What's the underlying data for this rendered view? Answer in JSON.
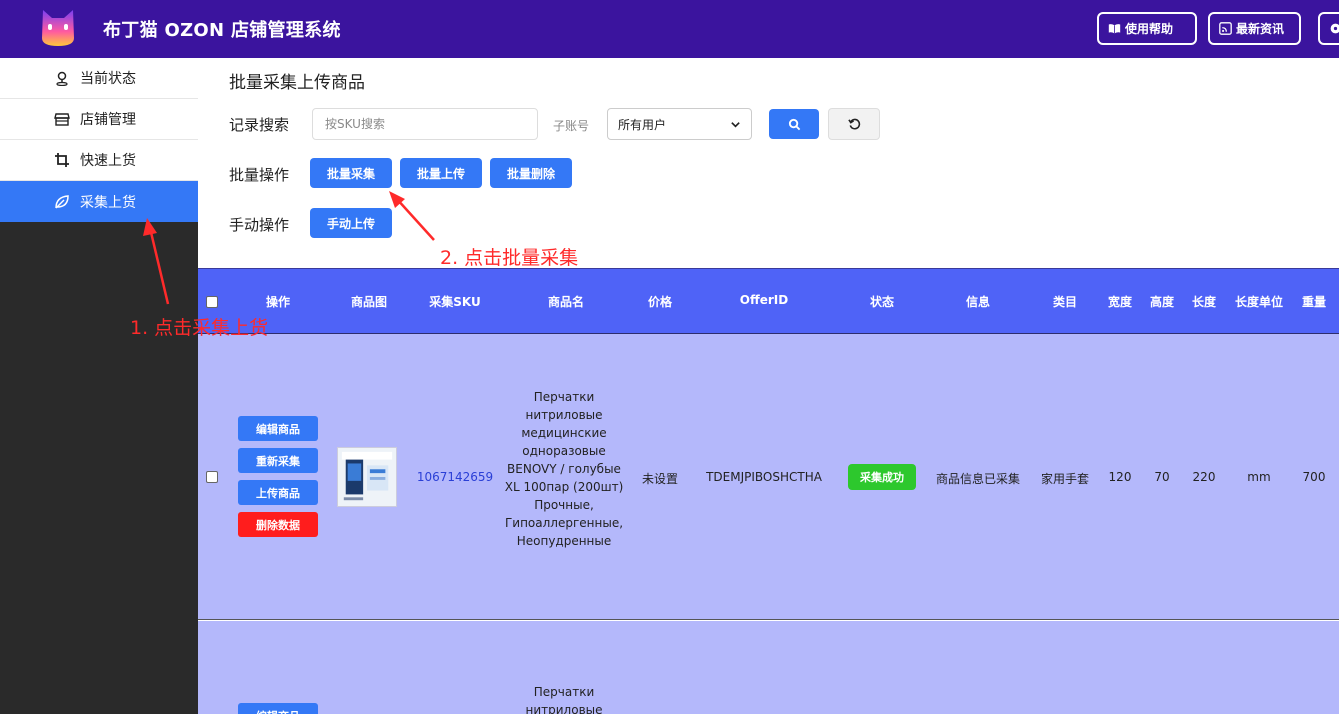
{
  "header": {
    "app_title": "布丁猫 OZON 店铺管理系统",
    "help_label": "使用帮助",
    "news_label": "最新资讯",
    "bg_color": "#3b149e"
  },
  "sidebar": {
    "items": [
      {
        "label": "当前状态",
        "icon": "location-icon"
      },
      {
        "label": "店铺管理",
        "icon": "store-icon"
      },
      {
        "label": "快速上货",
        "icon": "crop-icon"
      },
      {
        "label": "采集上货",
        "icon": "leaf-icon",
        "active": true
      }
    ],
    "active_color": "#3478f6"
  },
  "main": {
    "title": "批量采集上传商品",
    "search": {
      "label": "记录搜索",
      "placeholder": "按SKU搜索",
      "value": "",
      "sub_account_label": "子账号",
      "sub_account_value": "所有用户"
    },
    "bulk": {
      "label": "批量操作",
      "collect": "批量采集",
      "upload": "批量上传",
      "delete": "批量删除"
    },
    "manual": {
      "label": "手动操作",
      "upload": "手动上传"
    }
  },
  "annotations": {
    "step1": "1. 点击采集上货",
    "step2": "2. 点击批量采集"
  },
  "table": {
    "columns": [
      "操作",
      "商品图",
      "采集SKU",
      "商品名",
      "价格",
      "OfferID",
      "状态",
      "信息",
      "类目",
      "宽度",
      "高度",
      "长度",
      "长度单位",
      "重量"
    ],
    "row_actions": [
      "编辑商品",
      "重新采集",
      "上传商品",
      "删除数据"
    ],
    "rows": [
      {
        "sku": "1067142659",
        "name": "Перчатки нитриловые медицинские одноразовые BENOVY / голубые XL 100пар (200шт) Прочные, Гипоаллергенные, Неопудренные",
        "price": "未设置",
        "offer_id": "TDEMJPIBOSHCTHA",
        "status": "采集成功",
        "info": "商品信息已采集",
        "category": "家用手套",
        "width": "120",
        "height": "70",
        "length": "220",
        "length_unit": "mm",
        "weight": "700"
      },
      {
        "action_partial": "编辑商品",
        "name_partial": "Перчатки нитриловые"
      }
    ],
    "header_color": "#4f63f7",
    "row_color": "#b4b8fb"
  }
}
